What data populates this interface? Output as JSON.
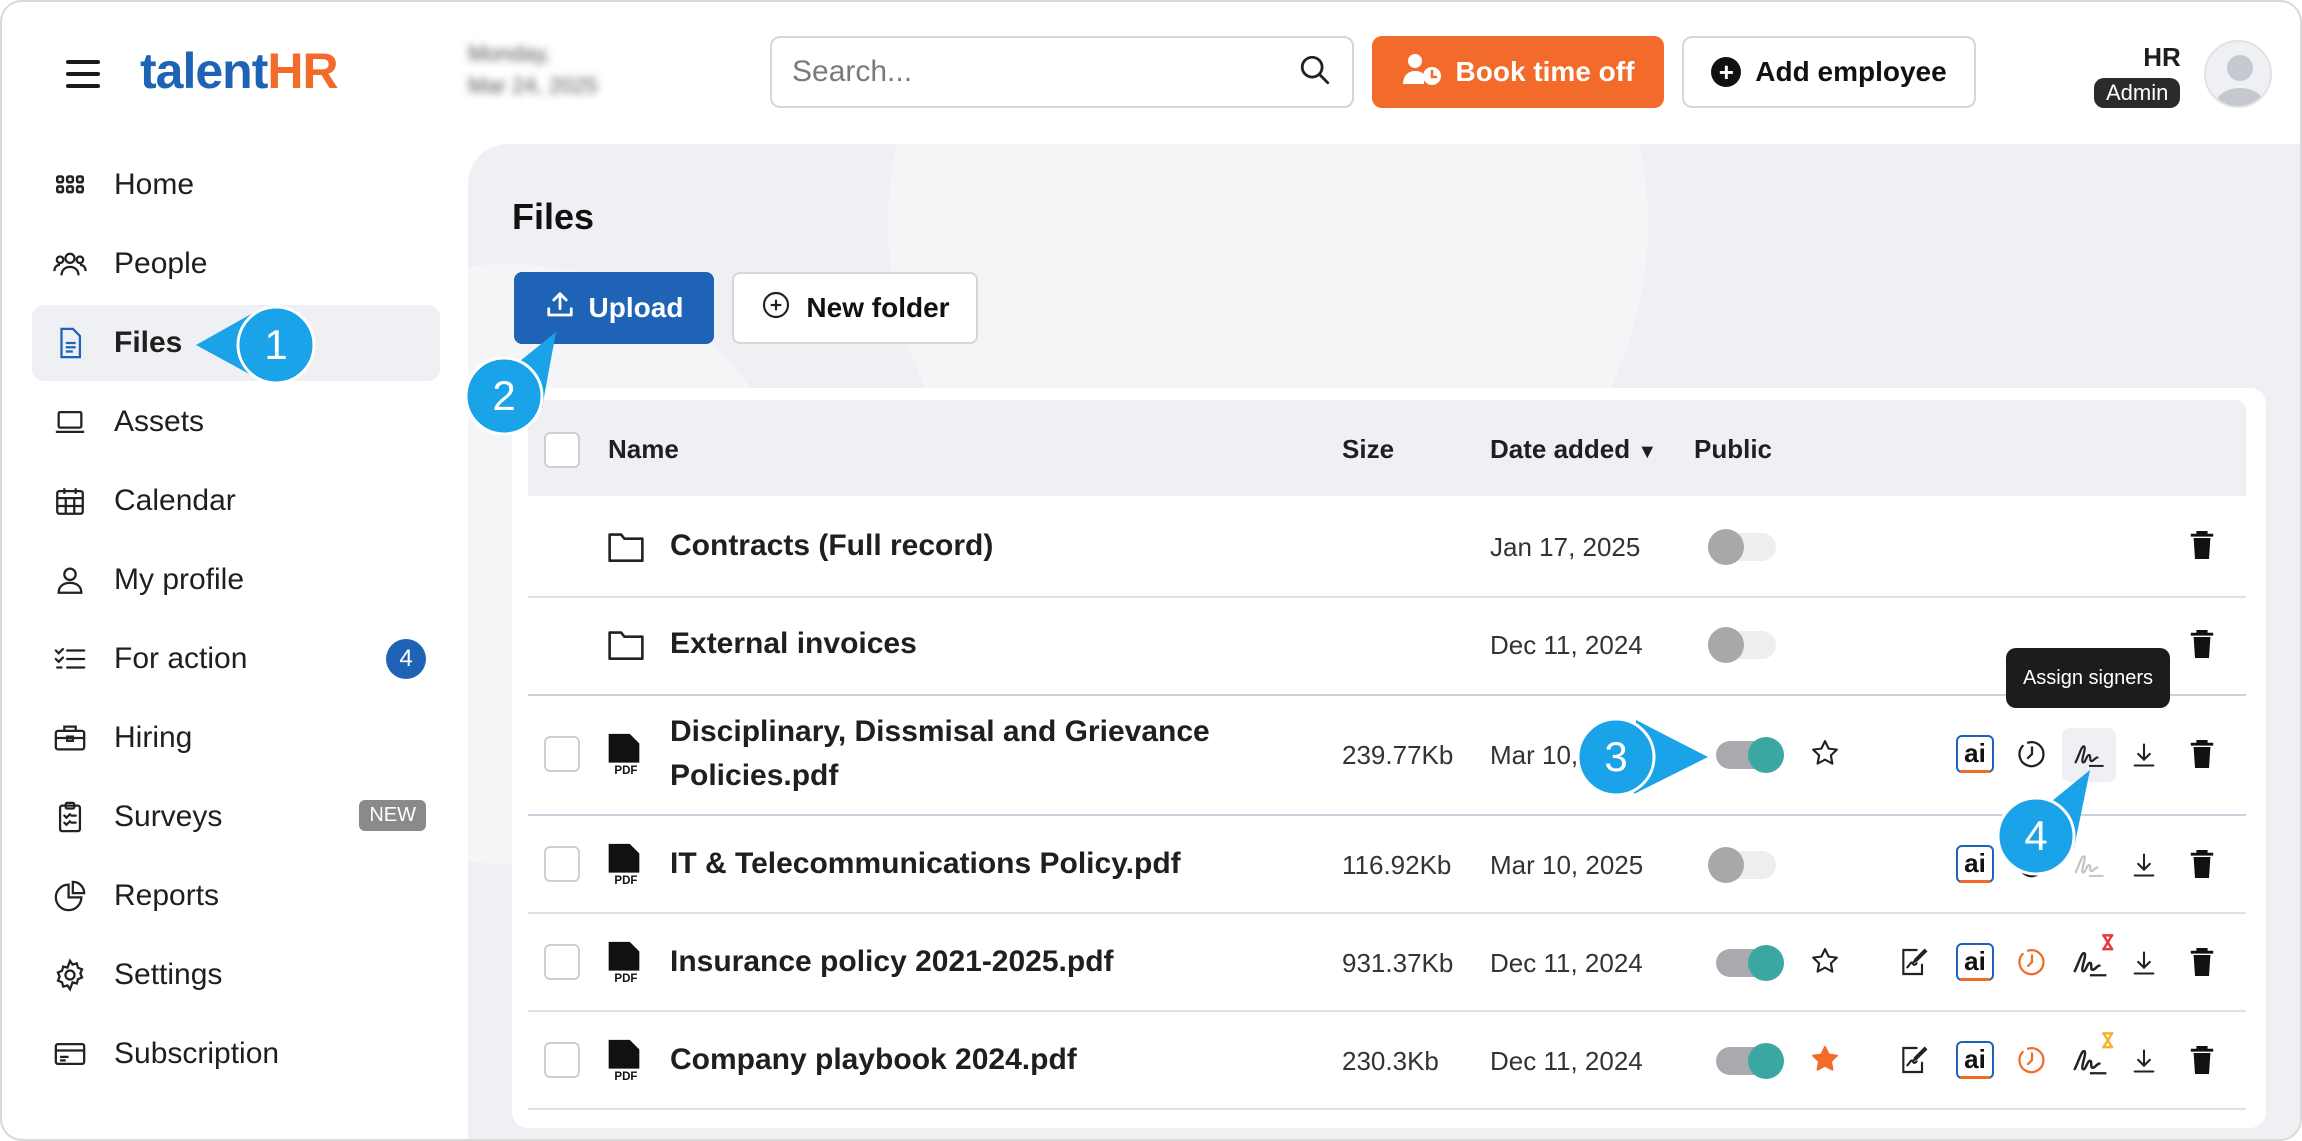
{
  "header": {
    "logo_left": "talent",
    "logo_right": "HR",
    "date_line1": "Monday,",
    "date_line2": "Mar 24, 2025",
    "search_placeholder": "Search...",
    "book_time_off": "Book time off",
    "add_employee": "Add employee",
    "user_name": "HR",
    "user_role": "Admin"
  },
  "sidebar": {
    "items": [
      {
        "label": "Home",
        "icon": "grid-icon"
      },
      {
        "label": "People",
        "icon": "people-icon"
      },
      {
        "label": "Files",
        "icon": "file-icon",
        "active": true
      },
      {
        "label": "Assets",
        "icon": "laptop-icon"
      },
      {
        "label": "Calendar",
        "icon": "calendar-icon"
      },
      {
        "label": "My profile",
        "icon": "person-icon"
      },
      {
        "label": "For action",
        "icon": "checklist-icon",
        "badge": "4"
      },
      {
        "label": "Hiring",
        "icon": "briefcase-icon"
      },
      {
        "label": "Surveys",
        "icon": "clipboard-icon",
        "badge": "NEW"
      },
      {
        "label": "Reports",
        "icon": "pie-chart-icon"
      },
      {
        "label": "Settings",
        "icon": "gear-icon"
      },
      {
        "label": "Subscription",
        "icon": "card-icon"
      }
    ]
  },
  "main": {
    "title": "Files",
    "upload": "Upload",
    "new_folder": "New folder",
    "columns": {
      "name": "Name",
      "size": "Size",
      "date": "Date added",
      "public": "Public"
    },
    "rows": [
      {
        "name": "Contracts (Full record)",
        "type": "folder",
        "size": "",
        "date": "Jan 17, 2025",
        "public": false
      },
      {
        "name": "External invoices",
        "type": "folder",
        "size": "",
        "date": "Dec 11, 2024",
        "public": false
      },
      {
        "name_line1": "Disciplinary, Dissmisal and Grievance",
        "name_line2": "Policies.pdf",
        "type": "pdf",
        "size": "239.77Kb",
        "date": "Mar 10,",
        "public": true,
        "starred": false
      },
      {
        "name": "IT & Telecommunications Policy.pdf",
        "type": "pdf",
        "size": "116.92Kb",
        "date": "Mar 10, 2025",
        "public": false
      },
      {
        "name": "Insurance policy 2021-2025.pdf",
        "type": "pdf",
        "size": "931.37Kb",
        "date": "Dec 11, 2024",
        "public": true,
        "starred": false
      },
      {
        "name": "Company playbook 2024.pdf",
        "type": "pdf",
        "size": "230.3Kb",
        "date": "Dec 11, 2024",
        "public": true,
        "starred": true
      }
    ],
    "pdf_label": "PDF",
    "ai_label": "ai",
    "tooltip": "Assign signers"
  },
  "callouts": [
    "1",
    "2",
    "3",
    "4"
  ],
  "colors": {
    "brand_blue": "#1e63b5",
    "brand_orange": "#f26b2a",
    "callout": "#1aa3e8",
    "toggle_on": "#3aa8a0"
  }
}
